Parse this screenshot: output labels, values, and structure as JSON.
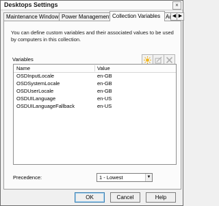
{
  "window": {
    "title": "Desktops Settings",
    "close_glyph": "×"
  },
  "tabs": [
    {
      "label": "Maintenance Windows",
      "active": false
    },
    {
      "label": "Power Management",
      "active": false
    },
    {
      "label": "Collection Variables",
      "active": true
    },
    {
      "label": "Ad",
      "active": false
    }
  ],
  "tab_scroll": {
    "left": "◀",
    "right": "▶"
  },
  "panel": {
    "description": "You can define custom variables and their associated values to be used by computers in this collection.",
    "variables_label": "Variables",
    "toolbar": [
      {
        "name": "new-variable-icon"
      },
      {
        "name": "edit-variable-icon"
      },
      {
        "name": "delete-variable-icon"
      }
    ],
    "columns": [
      "Name",
      "Value"
    ],
    "rows": [
      {
        "name": "OSDInputLocale",
        "value": "en-GB"
      },
      {
        "name": "OSDSystemLocale",
        "value": "en-GB"
      },
      {
        "name": "OSDUserLocale",
        "value": "en-GB"
      },
      {
        "name": "OSDUILanguage",
        "value": "en-US"
      },
      {
        "name": "OSDUILanguageFallback",
        "value": "en-US"
      }
    ],
    "precedence_label": "Precedence:",
    "precedence_value": "1 - Lowest"
  },
  "buttons": {
    "ok": "OK",
    "cancel": "Cancel",
    "help": "Help"
  },
  "colors": {
    "new_icon": "#f2b51a",
    "disabled_icon": "#b0b0b0",
    "default_button_border": "#3c7fb1"
  }
}
